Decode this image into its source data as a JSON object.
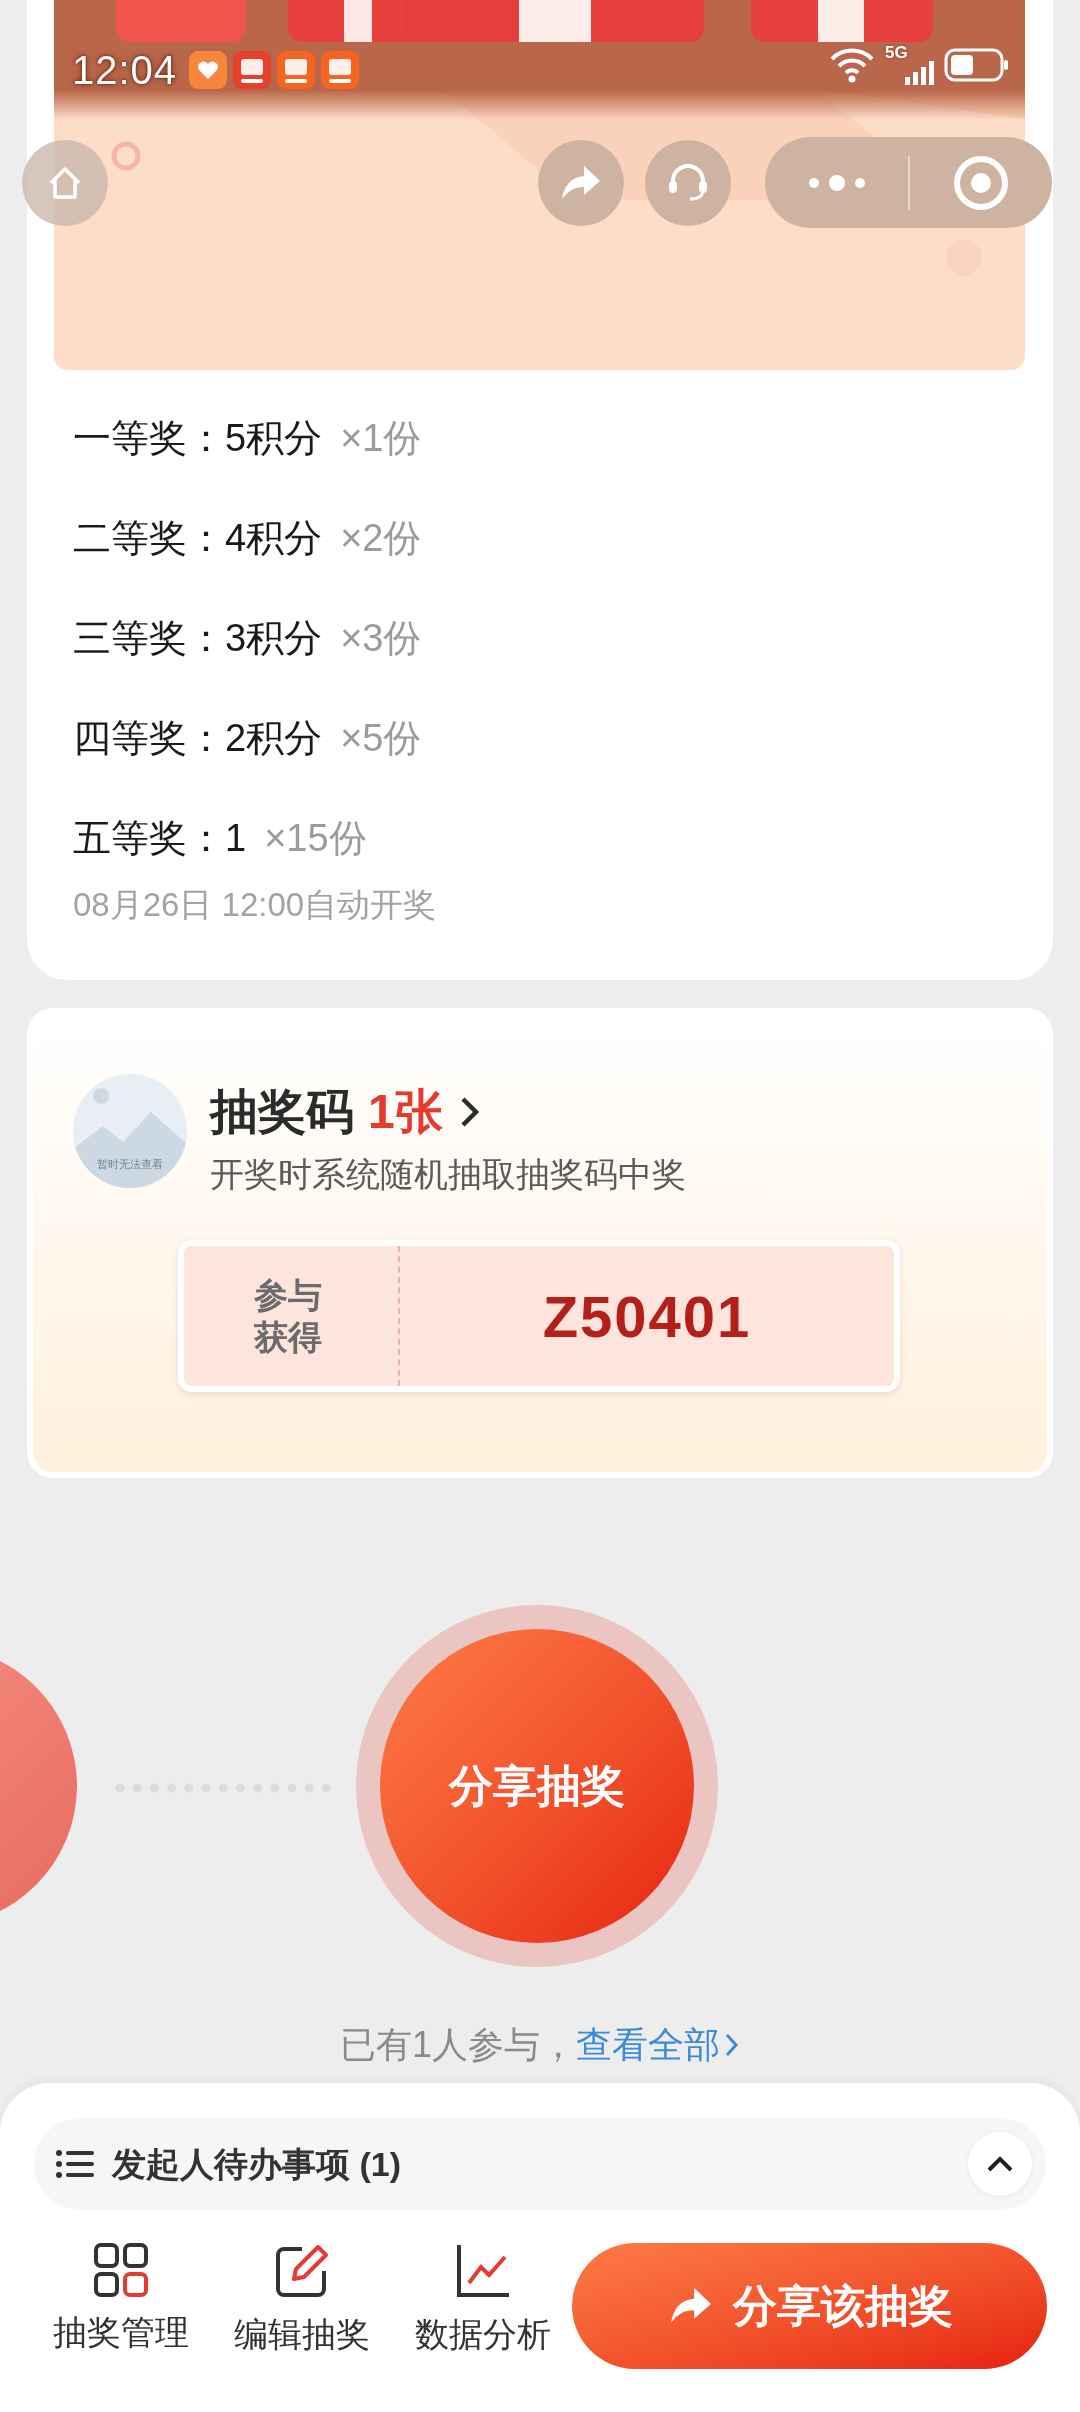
{
  "status_bar": {
    "time": "12:04",
    "network": "5G"
  },
  "prizes": [
    {
      "label": "一等奖：",
      "value": "5积分",
      "count": "×1份"
    },
    {
      "label": "二等奖：",
      "value": "4积分",
      "count": "×2份"
    },
    {
      "label": "三等奖：",
      "value": "3积分",
      "count": "×3份"
    },
    {
      "label": "四等奖：",
      "value": "2积分",
      "count": "×5份"
    },
    {
      "label": "五等奖：",
      "value": "1",
      "count": "×15份"
    }
  ],
  "draw_time": "08月26日 12:00自动开奖",
  "lottery_code": {
    "title": "抽奖码",
    "count": "1张",
    "subtitle": "开奖时系统随机抽取抽奖码中奖",
    "avatar_caption": "暂时无法查看",
    "ticket_label": "参与获得",
    "code": "Z50401"
  },
  "share_circle": {
    "label": "分享抽奖"
  },
  "participants": {
    "text": "已有1人参与，",
    "link": "查看全部"
  },
  "todo": {
    "label": "发起人待办事项 (1)"
  },
  "nav": [
    {
      "label": "抽奖管理",
      "kind": "grid"
    },
    {
      "label": "编辑抽奖",
      "kind": "edit"
    },
    {
      "label": "数据分析",
      "kind": "chart"
    }
  ],
  "share_button": {
    "label": "分享该抽奖"
  }
}
